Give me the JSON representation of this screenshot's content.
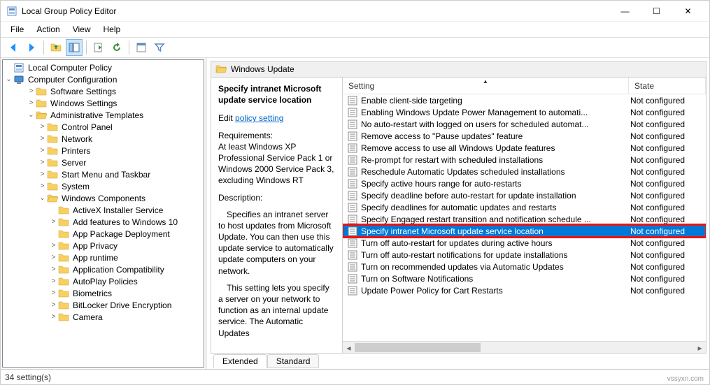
{
  "window": {
    "title": "Local Group Policy Editor"
  },
  "controls": {
    "min": "—",
    "max": "☐",
    "close": "✕"
  },
  "menu": [
    "File",
    "Action",
    "View",
    "Help"
  ],
  "tree": {
    "root": "Local Computer Policy",
    "cconf": "Computer Configuration",
    "items": [
      "Software Settings",
      "Windows Settings",
      "Administrative Templates",
      "Control Panel",
      "Network",
      "Printers",
      "Server",
      "Start Menu and Taskbar",
      "System",
      "Windows Components",
      "ActiveX Installer Service",
      "Add features to Windows 10",
      "App Package Deployment",
      "App Privacy",
      "App runtime",
      "Application Compatibility",
      "AutoPlay Policies",
      "Biometrics",
      "BitLocker Drive Encryption",
      "Camera"
    ]
  },
  "path": "Windows Update",
  "desc": {
    "heading": "Specify intranet Microsoft update service location",
    "edit_prefix": "Edit ",
    "edit_link": "policy setting",
    "req_label": "Requirements:",
    "req_body": "At least Windows XP Professional Service Pack 1 or Windows 2000 Service Pack 3, excluding Windows RT",
    "desc_label": "Description:",
    "desc_body1": "Specifies an intranet server to host updates from Microsoft Update. You can then use this update service to automatically update computers on your network.",
    "desc_body2": "This setting lets you specify a server on your network to function as an internal update service. The Automatic Updates"
  },
  "columns": {
    "setting": "Setting",
    "state": "State"
  },
  "settings": [
    {
      "n": "Enable client-side targeting",
      "s": "Not configured"
    },
    {
      "n": "Enabling Windows Update Power Management to automati...",
      "s": "Not configured"
    },
    {
      "n": "No auto-restart with logged on users for scheduled automat...",
      "s": "Not configured"
    },
    {
      "n": "Remove access to \"Pause updates\" feature",
      "s": "Not configured"
    },
    {
      "n": "Remove access to use all Windows Update features",
      "s": "Not configured"
    },
    {
      "n": "Re-prompt for restart with scheduled installations",
      "s": "Not configured"
    },
    {
      "n": "Reschedule Automatic Updates scheduled installations",
      "s": "Not configured"
    },
    {
      "n": "Specify active hours range for auto-restarts",
      "s": "Not configured"
    },
    {
      "n": "Specify deadline before auto-restart for update installation",
      "s": "Not configured"
    },
    {
      "n": "Specify deadlines for automatic updates and restarts",
      "s": "Not configured"
    },
    {
      "n": "Specify Engaged restart transition and notification schedule ...",
      "s": "Not configured"
    },
    {
      "n": "Specify intranet Microsoft update service location",
      "s": "Not configured",
      "sel": true
    },
    {
      "n": "Turn off auto-restart for updates during active hours",
      "s": "Not configured"
    },
    {
      "n": "Turn off auto-restart notifications for update installations",
      "s": "Not configured"
    },
    {
      "n": "Turn on recommended updates via Automatic Updates",
      "s": "Not configured"
    },
    {
      "n": "Turn on Software Notifications",
      "s": "Not configured"
    },
    {
      "n": "Update Power Policy for Cart Restarts",
      "s": "Not configured"
    }
  ],
  "tabs": {
    "extended": "Extended",
    "standard": "Standard"
  },
  "status": "34 setting(s)",
  "watermark": "vssyxn.com"
}
